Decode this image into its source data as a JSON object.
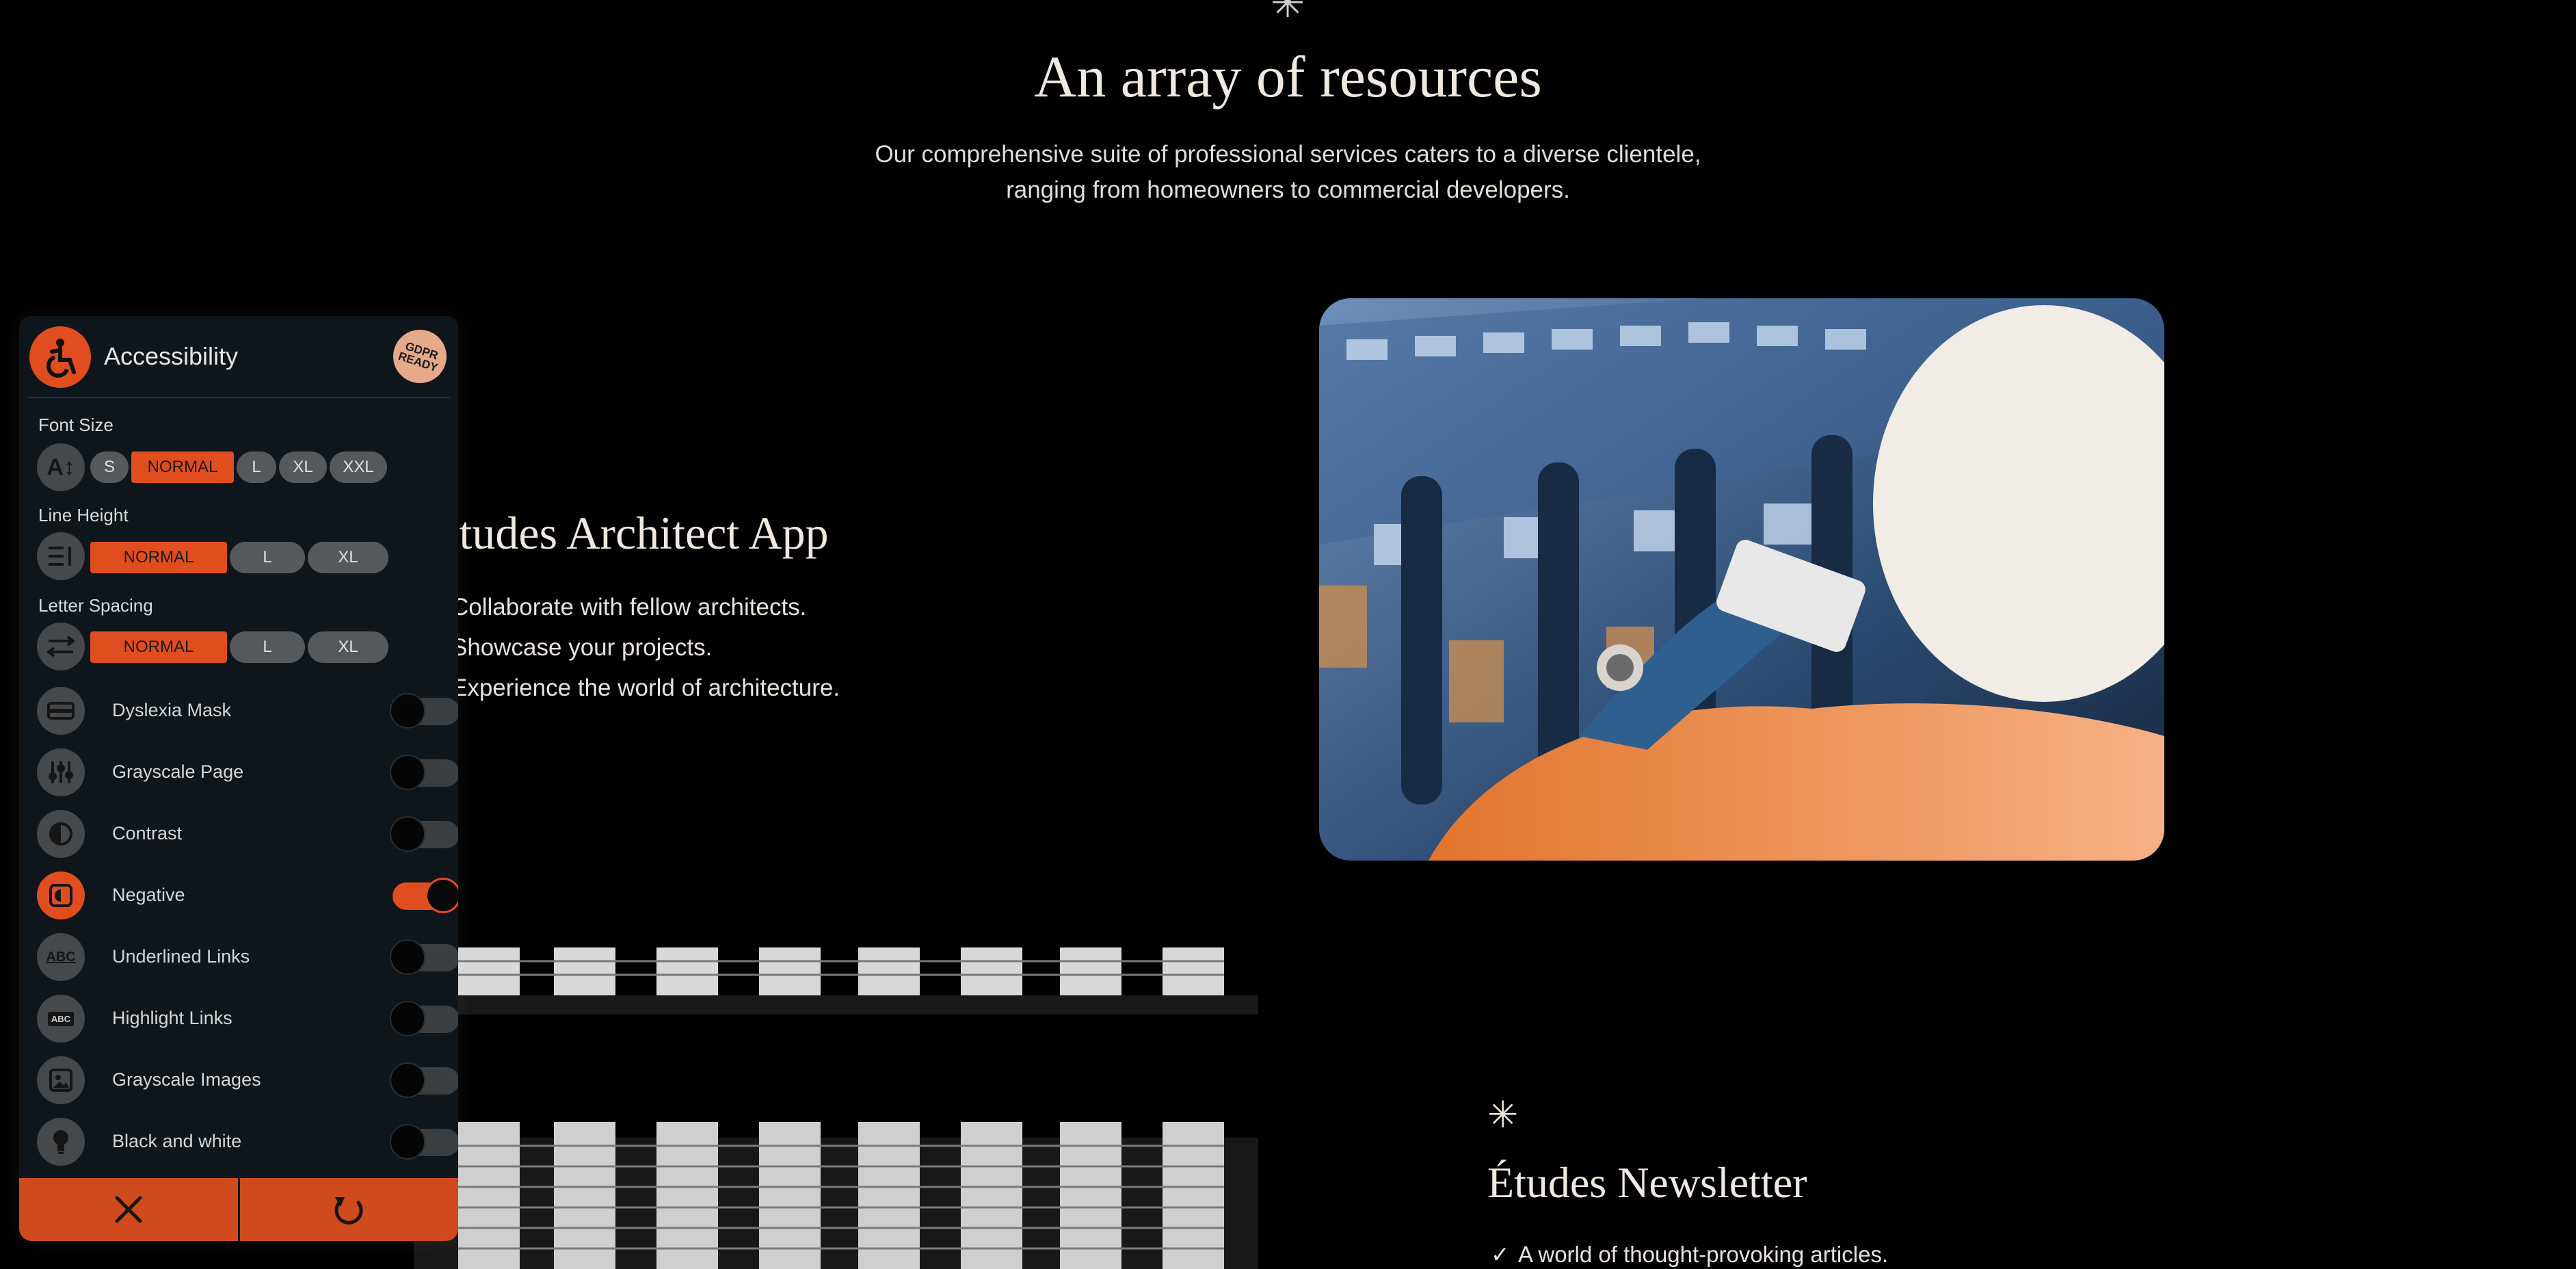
{
  "hero": {
    "title": "An array of resources",
    "subtitle": "Our comprehensive suite of professional services caters to a diverse clientele, ranging from homeowners to commercial developers."
  },
  "app": {
    "title": "Études Architect App",
    "bullets": [
      "Collaborate with fellow architects.",
      "Showcase your projects.",
      "Experience the world of architecture."
    ]
  },
  "newsletter": {
    "title": "Études Newsletter",
    "items": [
      "A world of thought-provoking articles."
    ]
  },
  "accessibility": {
    "title": "Accessibility",
    "badge": "GDPR READY",
    "font_size": {
      "label": "Font Size",
      "options": [
        "S",
        "NORMAL",
        "L",
        "XL",
        "XXL"
      ],
      "selected": "NORMAL"
    },
    "line_height": {
      "label": "Line Height",
      "options": [
        "NORMAL",
        "L",
        "XL"
      ],
      "selected": "NORMAL"
    },
    "letter_spacing": {
      "label": "Letter Spacing",
      "options": [
        "NORMAL",
        "L",
        "XL"
      ],
      "selected": "NORMAL"
    },
    "toggles": [
      {
        "label": "Dyslexia Mask",
        "on": false,
        "icon": "dyslexia-mask-icon"
      },
      {
        "label": "Grayscale Page",
        "on": false,
        "icon": "sliders-icon"
      },
      {
        "label": "Contrast",
        "on": false,
        "icon": "contrast-icon"
      },
      {
        "label": "Negative",
        "on": true,
        "icon": "negative-icon"
      },
      {
        "label": "Underlined Links",
        "on": false,
        "icon": "abc-underline-icon"
      },
      {
        "label": "Highlight Links",
        "on": false,
        "icon": "abc-highlight-icon"
      },
      {
        "label": "Grayscale Images",
        "on": false,
        "icon": "image-icon"
      },
      {
        "label": "Black and white",
        "on": false,
        "icon": "lightbulb-icon"
      }
    ],
    "accent_color": "#e04e1f"
  }
}
